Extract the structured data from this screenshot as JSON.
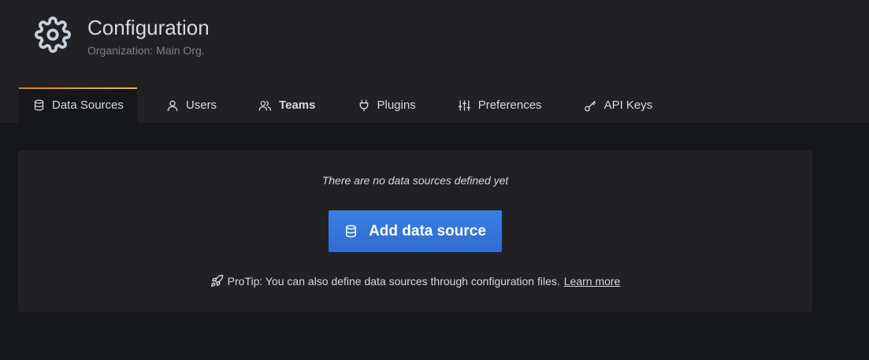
{
  "header": {
    "icon": "gear-icon",
    "title": "Configuration",
    "subtitle": "Organization: Main Org."
  },
  "tabs": [
    {
      "label": "Data Sources",
      "icon": "database-icon",
      "active": true
    },
    {
      "label": "Users",
      "icon": "user-icon"
    },
    {
      "label": "Teams",
      "icon": "users-icon"
    },
    {
      "label": "Plugins",
      "icon": "plug-icon"
    },
    {
      "label": "Preferences",
      "icon": "sliders-icon"
    },
    {
      "label": "API Keys",
      "icon": "key-icon"
    }
  ],
  "empty_state": {
    "message": "There are no data sources defined yet",
    "button_label": "Add data source",
    "button_icon": "database-icon",
    "protip_icon": "rocket-icon",
    "protip_text": "ProTip: You can also define data sources through configuration files.",
    "learn_more": "Learn more"
  },
  "colors": {
    "header_bg": "#212124",
    "page_bg": "#161719",
    "button_blue": "#3274d9",
    "tab_accent_start": "#eb7b18",
    "tab_accent_end": "#f5b73d"
  }
}
